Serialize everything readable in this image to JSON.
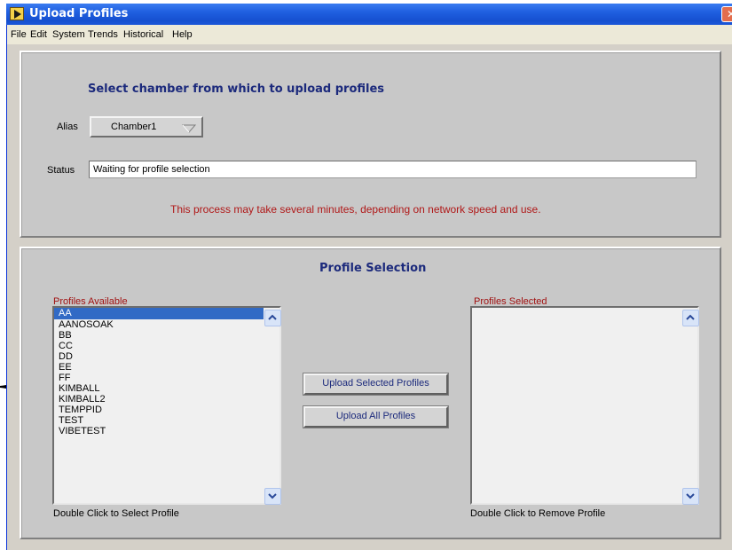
{
  "window": {
    "title": "Upload Profiles"
  },
  "menubar": {
    "items": [
      "File",
      "Edit",
      "System",
      "Trends",
      "Historical",
      "Help"
    ]
  },
  "chamber_panel": {
    "heading": "Select chamber from which to upload profiles",
    "alias_label": "Alias",
    "alias_value": "Chamber1",
    "status_label": "Status",
    "status_value": "Waiting for profile selection",
    "warning": "This process may take several minutes, depending on network speed and use."
  },
  "selection_panel": {
    "heading": "Profile Selection",
    "available_label": "Profiles Available",
    "available_items": [
      "AA",
      "AANOSOAK",
      "BB",
      "CC",
      "DD",
      "EE",
      "FF",
      "KIMBALL",
      "KIMBALL2",
      "TEMPPID",
      "TEST",
      "VIBETEST"
    ],
    "available_selected": "AA",
    "available_hint": "Double Click to Select Profile",
    "selected_label": "Profiles Selected",
    "selected_items": [],
    "selected_hint": "Double Click to Remove Profile",
    "upload_selected_button": "Upload Selected Profiles",
    "upload_all_button": "Upload All Profiles"
  },
  "colors": {
    "title_bar": "#1f5fe0",
    "panel_bg": "#c8c8c8",
    "heading": "#1c2a7c",
    "warning": "#b01818",
    "list_selection": "#316ac5"
  }
}
